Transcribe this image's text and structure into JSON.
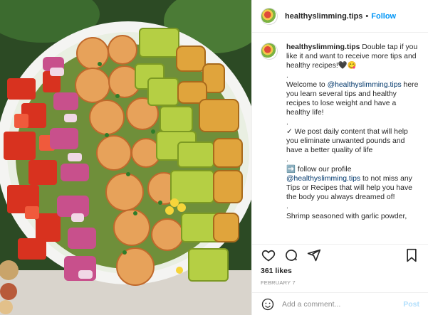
{
  "post": {
    "username": "healthyslimming.tips",
    "follow_label": "Follow",
    "header_separator": "•"
  },
  "caption": {
    "lines": [
      " Double tap if you like it and want to receive more tips and healthy recipes!🖤😋",
      ".",
      "Welcome to ",
      "@healthyslimming.tips",
      " here you learn several tips and healthy recipes to lose weight and have a healthy life!",
      ".",
      "✓ We post daily content that will help you eliminate unwanted pounds and have a better quality of life",
      ".",
      "➡️ follow our profile ",
      "@healthyslimming.tips",
      " to not miss any Tips or Recipes that will help you have the body you always dreamed of!",
      ".",
      "Shrimp seasoned with garlic powder,"
    ]
  },
  "likes": "361 likes",
  "date": "FEBRUARY 7",
  "comment": {
    "placeholder": "Add a comment...",
    "post_label": "Post"
  },
  "icons": {
    "like": "heart-icon",
    "comment": "comment-icon",
    "share": "share-icon",
    "save": "bookmark-icon",
    "emoji": "emoji-icon"
  }
}
